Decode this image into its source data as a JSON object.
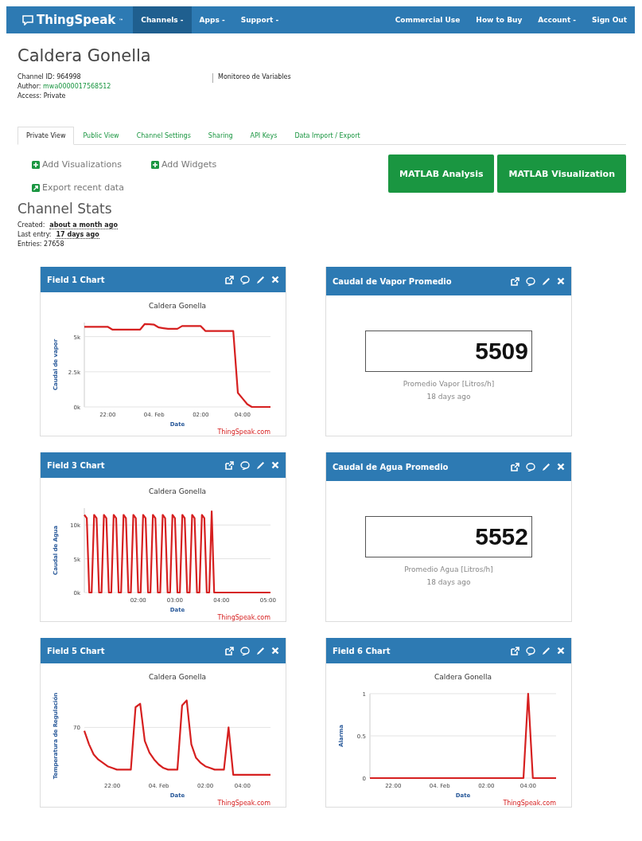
{
  "navbar": {
    "brand": "ThingSpeak",
    "trademark": "™",
    "left": [
      {
        "label": "Channels -",
        "selected": true
      },
      {
        "label": "Apps -",
        "selected": false
      },
      {
        "label": "Support -",
        "selected": false
      }
    ],
    "right": [
      "Commercial Use",
      "How to Buy",
      "Account -",
      "Sign Out"
    ]
  },
  "channel": {
    "title": "Caldera Gonella",
    "id_label": "Channel ID:",
    "id": "964998",
    "author_label": "Author:",
    "author": "mwa0000017568512",
    "access": "Access: Private",
    "description": "Monitoreo de Variables"
  },
  "tabs": [
    {
      "label": "Private View",
      "selected": true
    },
    {
      "label": "Public View",
      "selected": false
    },
    {
      "label": "Channel Settings",
      "selected": false
    },
    {
      "label": "Sharing",
      "selected": false
    },
    {
      "label": "API Keys",
      "selected": false
    },
    {
      "label": "Data Import / Export",
      "selected": false
    }
  ],
  "actions": [
    "Add Visualizations",
    "Add Widgets",
    "Export recent data"
  ],
  "buttons": [
    "MATLAB Analysis",
    "MATLAB Visualization"
  ],
  "stats": {
    "title": "Channel Stats",
    "created_label": "Created:",
    "created": "about a month ago",
    "last_label": "Last entry:",
    "last": "17 days ago",
    "entries": "Entries: 27658"
  },
  "widgets": [
    {
      "kind": "chart",
      "title": "Field 1 Chart",
      "credit": "ThingSpeak.com",
      "chart_data": {
        "type": "line",
        "title": "Caldera Gonella",
        "xlabel": "Date",
        "ylabel": "Caudal de vapor",
        "grid": true,
        "ylim": [
          0,
          6000
        ],
        "yticks": [
          {
            "value": 0,
            "label": "0k"
          },
          {
            "value": 2500,
            "label": "2.5k"
          },
          {
            "value": 5000,
            "label": "5k"
          }
        ],
        "categories": [
          null,
          null,
          null,
          null,
          null,
          "22:00",
          null,
          null,
          null,
          null,
          null,
          null,
          null,
          null,
          null,
          "04. Feb",
          null,
          null,
          null,
          null,
          null,
          null,
          null,
          null,
          null,
          "02:00",
          null,
          null,
          null,
          null,
          null,
          null,
          null,
          null,
          "04:00",
          null,
          null,
          null,
          null,
          null,
          null
        ],
        "series": [
          {
            "color": "#d62020",
            "values": [
              5700,
              5700,
              5700,
              5700,
              5700,
              5700,
              5500,
              5500,
              5500,
              5500,
              5500,
              5500,
              5500,
              5900,
              5880,
              5850,
              5650,
              5600,
              5550,
              5550,
              5550,
              5750,
              5750,
              5750,
              5750,
              5750,
              5400,
              5400,
              5400,
              5400,
              5400,
              5400,
              5400,
              1000,
              600,
              200,
              0,
              0,
              0,
              0,
              0
            ]
          }
        ]
      }
    },
    {
      "kind": "numeric",
      "title": "Caudal de Vapor Promedio",
      "value": "5509",
      "caption": "Promedio Vapor [Litros/h]",
      "time": "18 days ago"
    },
    {
      "kind": "chart",
      "title": "Field 3 Chart",
      "credit": "ThingSpeak.com",
      "chart_data": {
        "type": "line",
        "title": "Caldera Gonella",
        "xlabel": "Date",
        "ylabel": "Caudal de Agua",
        "grid": true,
        "ylim": [
          0,
          12500
        ],
        "yticks": [
          {
            "value": 0,
            "label": "0k"
          },
          {
            "value": 5000,
            "label": "5k"
          },
          {
            "value": 10000,
            "label": "10k"
          }
        ],
        "categories": [
          null,
          null,
          null,
          null,
          null,
          null,
          null,
          null,
          null,
          null,
          null,
          null,
          null,
          null,
          null,
          null,
          null,
          null,
          null,
          null,
          null,
          null,
          "02:00",
          null,
          null,
          null,
          null,
          null,
          null,
          null,
          null,
          null,
          null,
          null,
          null,
          null,
          null,
          "03:00",
          null,
          null,
          null,
          null,
          null,
          null,
          null,
          null,
          null,
          null,
          null,
          null,
          null,
          null,
          null,
          null,
          null,
          null,
          "04:00",
          null,
          null,
          null,
          null,
          null,
          null,
          null,
          null,
          null,
          null,
          null,
          null,
          null,
          null,
          null,
          null,
          null,
          null,
          "05:00",
          null
        ],
        "series": [
          {
            "color": "#d62020",
            "values": [
              11500,
              11000,
              0,
              0,
              11500,
              11000,
              0,
              0,
              11500,
              11000,
              0,
              0,
              11500,
              11000,
              0,
              0,
              11500,
              11000,
              0,
              0,
              11500,
              11000,
              0,
              0,
              11500,
              11000,
              0,
              0,
              11500,
              11000,
              0,
              0,
              11500,
              11000,
              0,
              0,
              11500,
              11000,
              0,
              0,
              11500,
              11000,
              0,
              0,
              11500,
              11000,
              0,
              0,
              11500,
              11000,
              0,
              0,
              12000,
              0,
              0,
              0,
              0,
              0,
              0,
              0,
              0,
              0,
              0,
              0,
              0,
              0,
              0,
              0,
              0,
              0,
              0,
              0,
              0,
              0,
              0,
              0,
              0
            ]
          }
        ]
      }
    },
    {
      "kind": "numeric",
      "title": "Caudal de Agua Promedio",
      "value": "5552",
      "caption": "Promedio Agua [Litros/h]",
      "time": "18 days ago"
    },
    {
      "kind": "chart_picture",
      "title": "Field 5 Chart",
      "credit": "ThingSpeak.com",
      "chart_title": "Caldera Gonella",
      "xlabel": "Date",
      "ylabel": "Temperatura de Regulación",
      "y_label": "70",
      "x_labels": [
        "22:00",
        "04. Feb",
        "02:00",
        "04:00"
      ]
    },
    {
      "kind": "chart",
      "title": "Field 6 Chart",
      "credit": "ThingSpeak.com",
      "chart_data": {
        "type": "line",
        "title": "Caldera Gonella",
        "xlabel": "Date",
        "ylabel": "Alarma",
        "grid": true,
        "ylim": [
          0,
          1
        ],
        "yticks": [
          0,
          0.5,
          1
        ],
        "categories": [
          null,
          null,
          null,
          null,
          null,
          "22:00",
          null,
          null,
          null,
          null,
          null,
          null,
          null,
          null,
          null,
          "04. Feb",
          null,
          null,
          null,
          null,
          null,
          null,
          null,
          null,
          null,
          "02:00",
          null,
          null,
          null,
          null,
          null,
          null,
          null,
          null,
          "04:00",
          null,
          null,
          null,
          null,
          null,
          null
        ],
        "series": [
          {
            "color": "#d62020",
            "values": [
              0,
              0,
              0,
              0,
              0,
              0,
              0,
              0,
              0,
              0,
              0,
              0,
              0,
              0,
              0,
              0,
              0,
              0,
              0,
              0,
              0,
              0,
              0,
              0,
              0,
              0,
              0,
              0,
              0,
              0,
              0,
              0,
              0,
              0,
              1,
              0,
              0,
              0,
              0,
              0,
              0
            ]
          }
        ]
      }
    }
  ]
}
